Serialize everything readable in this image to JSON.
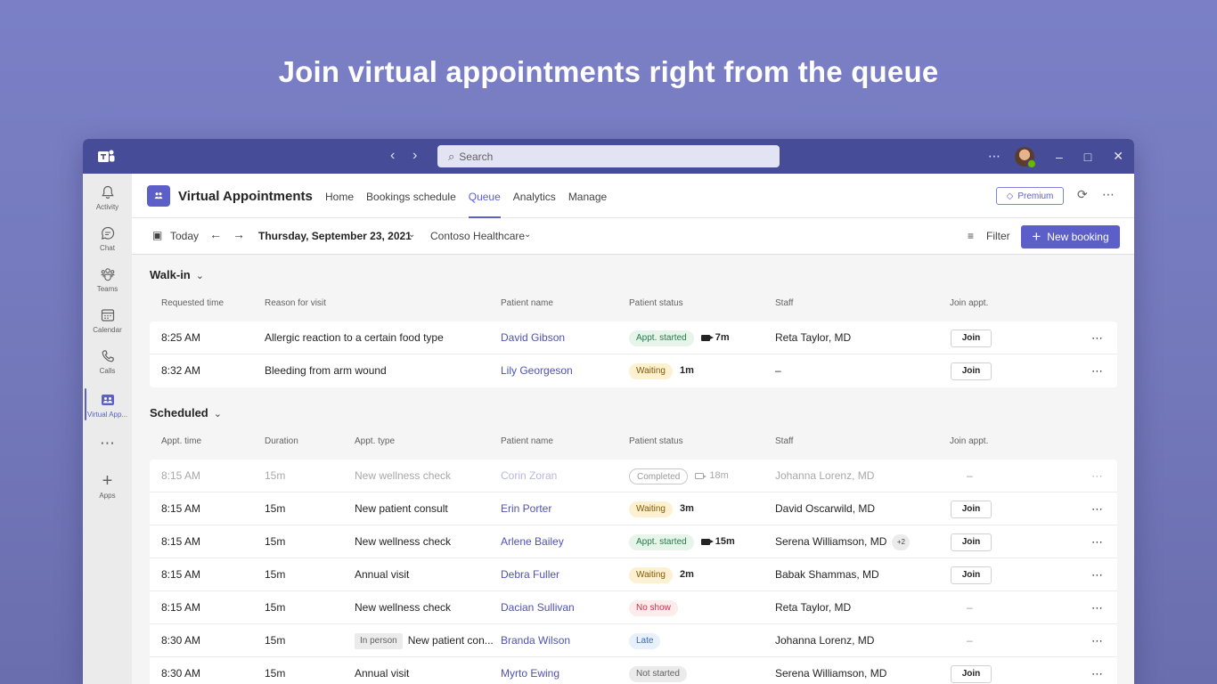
{
  "headline": "Join virtual appointments right from the queue",
  "titlebar": {
    "search_placeholder": "Search",
    "more": "⋯",
    "minimize": "–",
    "maximize": "□",
    "close": "✕"
  },
  "rail": {
    "items": [
      {
        "label": "Activity",
        "icon": "bell-icon",
        "glyph": "🔔"
      },
      {
        "label": "Chat",
        "icon": "chat-icon",
        "glyph": "💬"
      },
      {
        "label": "Teams",
        "icon": "teams-icon",
        "glyph": "⚘"
      },
      {
        "label": "Calendar",
        "icon": "calendar-icon",
        "glyph": "▦"
      },
      {
        "label": "Calls",
        "icon": "phone-icon",
        "glyph": "☏"
      },
      {
        "label": "Virtual App...",
        "icon": "virtual-appointments-icon",
        "glyph": "☷"
      },
      {
        "label": "",
        "icon": "more-icon",
        "glyph": "⋯"
      },
      {
        "label": "Apps",
        "icon": "plus-icon",
        "glyph": "+"
      }
    ]
  },
  "app": {
    "title": "Virtual Appointments",
    "tabs": [
      "Home",
      "Bookings schedule",
      "Queue",
      "Analytics",
      "Manage"
    ],
    "active_tab": "Queue",
    "premium_label": "Premium"
  },
  "toolbar": {
    "today": "Today",
    "date": "Thursday, September 23, 2021",
    "org": "Contoso Healthcare",
    "filter": "Filter",
    "new_booking": "New booking"
  },
  "walkin": {
    "title": "Walk-in",
    "columns": [
      "Requested time",
      "Reason for visit",
      "Patient name",
      "Patient status",
      "Staff",
      "Join appt."
    ],
    "rows": [
      {
        "time": "8:25 AM",
        "reason": "Allergic reaction to a certain food type",
        "patient": "David Gibson",
        "status": "Appt. started",
        "status_type": "started",
        "video": true,
        "wait": "7m",
        "staff": "Reta Taylor, MD",
        "join": "Join"
      },
      {
        "time": "8:32 AM",
        "reason": "Bleeding from arm wound",
        "patient": "Lily Georgeson",
        "status": "Waiting",
        "status_type": "waiting",
        "video": false,
        "wait": "1m",
        "staff": "–",
        "join": "Join"
      }
    ]
  },
  "scheduled": {
    "title": "Scheduled",
    "columns": [
      "Appt. time",
      "Duration",
      "Appt. type",
      "Patient name",
      "Patient status",
      "Staff",
      "Join appt."
    ],
    "rows": [
      {
        "time": "8:15 AM",
        "duration": "15m",
        "type": "New wellness check",
        "tag": "",
        "patient": "Corin Zoran",
        "status": "Completed",
        "status_type": "completed",
        "video": true,
        "wait": "18m",
        "staff": "Johanna Lorenz, MD",
        "extra": "",
        "join": "–",
        "muted": true
      },
      {
        "time": "8:15 AM",
        "duration": "15m",
        "type": "New patient consult",
        "tag": "",
        "patient": "Erin Porter",
        "status": "Waiting",
        "status_type": "waiting",
        "video": false,
        "wait": "3m",
        "staff": "David Oscarwild, MD",
        "extra": "",
        "join": "Join",
        "muted": false
      },
      {
        "time": "8:15 AM",
        "duration": "15m",
        "type": "New wellness check",
        "tag": "",
        "patient": "Arlene Bailey",
        "status": "Appt. started",
        "status_type": "started",
        "video": true,
        "wait": "15m",
        "staff": "Serena Williamson, MD",
        "extra": "+2",
        "join": "Join",
        "muted": false
      },
      {
        "time": "8:15 AM",
        "duration": "15m",
        "type": "Annual visit",
        "tag": "",
        "patient": "Debra Fuller",
        "status": "Waiting",
        "status_type": "waiting",
        "video": false,
        "wait": "2m",
        "staff": "Babak Shammas, MD",
        "extra": "",
        "join": "Join",
        "muted": false
      },
      {
        "time": "8:15 AM",
        "duration": "15m",
        "type": "New wellness check",
        "tag": "",
        "patient": "Dacian Sullivan",
        "status": "No show",
        "status_type": "noshow",
        "video": false,
        "wait": "",
        "staff": "Reta Taylor, MD",
        "extra": "",
        "join": "–",
        "muted": false
      },
      {
        "time": "8:30 AM",
        "duration": "15m",
        "type": "New patient con...",
        "tag": "In person",
        "patient": "Branda Wilson",
        "status": "Late",
        "status_type": "late",
        "video": false,
        "wait": "",
        "staff": "Johanna Lorenz, MD",
        "extra": "",
        "join": "–",
        "muted": false
      },
      {
        "time": "8:30 AM",
        "duration": "15m",
        "type": "Annual visit",
        "tag": "",
        "patient": "Myrto Ewing",
        "status": "Not started",
        "status_type": "notstarted",
        "video": false,
        "wait": "",
        "staff": "Serena Williamson, MD",
        "extra": "",
        "join": "Join",
        "muted": false
      }
    ]
  },
  "colors": {
    "accent": "#5b5fc7",
    "titlebar": "#464c97",
    "background": "#7b80c6"
  }
}
